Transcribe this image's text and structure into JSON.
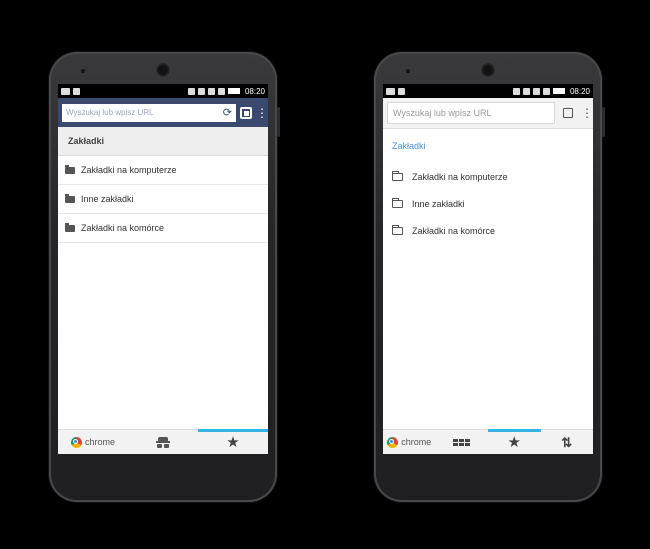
{
  "status_bar": {
    "time": "08:20"
  },
  "left_phone": {
    "search": {
      "placeholder": "Wyszukaj lub wpisz URL"
    },
    "bookmarks": {
      "header": "Zakładki",
      "items": [
        {
          "label": "Zakładki na komputerze"
        },
        {
          "label": "Inne zakładki"
        },
        {
          "label": "Zakładki na komórce"
        }
      ]
    },
    "bottom_nav": {
      "chrome_label": "chrome",
      "active_tab": "bookmarks"
    }
  },
  "right_phone": {
    "search": {
      "placeholder": "Wyszukaj lub wpisz URL"
    },
    "bookmarks": {
      "header": "Zakładki",
      "items": [
        {
          "label": "Zakładki na komputerze"
        },
        {
          "label": "Inne zakładki"
        },
        {
          "label": "Zakładki na komórce"
        }
      ]
    },
    "bottom_nav": {
      "chrome_label": "chrome",
      "active_tab": "bookmarks"
    }
  },
  "colors": {
    "accent": "#33b5e5",
    "toolbar_old": "#394a6e",
    "header_link": "#4a90d9"
  }
}
